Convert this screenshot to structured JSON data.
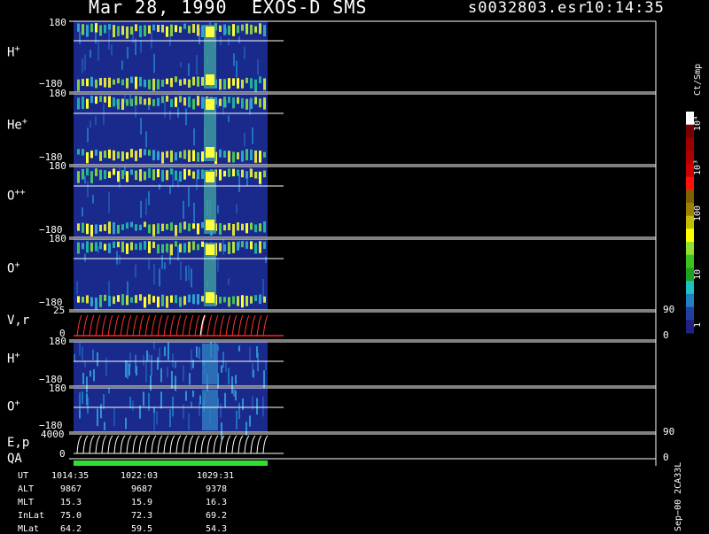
{
  "header": {
    "date": "Mar 28, 1990",
    "instrument": "EXOS-D SMS",
    "file": "s0032803.esr",
    "time": "10:14:35"
  },
  "colorbar": {
    "unit": "Ct/Smp",
    "labels": [
      "10⁴",
      "10³",
      "100",
      "10",
      "1"
    ],
    "colors": [
      "#ffffff",
      "#7a0000",
      "#9a0000",
      "#b00000",
      "#cc0000",
      "#ff1010",
      "#806000",
      "#a08000",
      "#c0c000",
      "#ffff00",
      "#90e030",
      "#40c020",
      "#20a020",
      "#20c0c0",
      "#2080c0",
      "#2040a0",
      "#202080"
    ]
  },
  "panels": [
    {
      "label": "H",
      "sup": "+",
      "top": "180",
      "bottom": "−180"
    },
    {
      "label": "He",
      "sup": "+",
      "top": "180",
      "bottom": "−180"
    },
    {
      "label": "O",
      "sup": "++",
      "top": "180",
      "bottom": "−180"
    },
    {
      "label": "O",
      "sup": "+",
      "top": "180",
      "bottom": "−180"
    },
    {
      "label": "V,r",
      "sup": "",
      "top": "25",
      "bottom": "0",
      "right_top": "90",
      "right_bottom": "0"
    },
    {
      "label": "H",
      "sup": "+",
      "top": "180",
      "bottom": "−180"
    },
    {
      "label": "O",
      "sup": "+",
      "top": "180",
      "bottom": "−180"
    },
    {
      "label": "E,p",
      "sup": "",
      "top": "4000",
      "bottom": "0",
      "right_top": "90",
      "right_bottom": "0"
    }
  ],
  "qa_label": "QA",
  "footer": {
    "rows": [
      {
        "label": "UT",
        "values": [
          "1014:35",
          "1022:03",
          "1029:31"
        ]
      },
      {
        "label": "ALT",
        "values": [
          "9867",
          "9687",
          "9378"
        ]
      },
      {
        "label": "MLT",
        "values": [
          "15.3",
          "15.9",
          "16.3"
        ]
      },
      {
        "label": "InLat",
        "values": [
          "75.0",
          "72.3",
          "69.2"
        ]
      },
      {
        "label": "MLat",
        "values": [
          "64.2",
          "59.5",
          "54.3"
        ]
      }
    ],
    "version": "Sep−00 2CA33L"
  },
  "chart_data": {
    "type": "heatmap",
    "title": "Mar 28, 1990   EXOS-D SMS",
    "time_ticks": [
      "1014:35",
      "1022:03",
      "1029:31"
    ],
    "panel_ylims": [
      [
        -180,
        180
      ],
      [
        -180,
        180
      ],
      [
        -180,
        180
      ],
      [
        -180,
        180
      ],
      [
        0,
        25
      ],
      [
        -180,
        180
      ],
      [
        -180,
        180
      ],
      [
        0,
        4000
      ]
    ],
    "colorbar_range": [
      1,
      10000
    ],
    "colorbar_unit": "Ct/Smp"
  }
}
